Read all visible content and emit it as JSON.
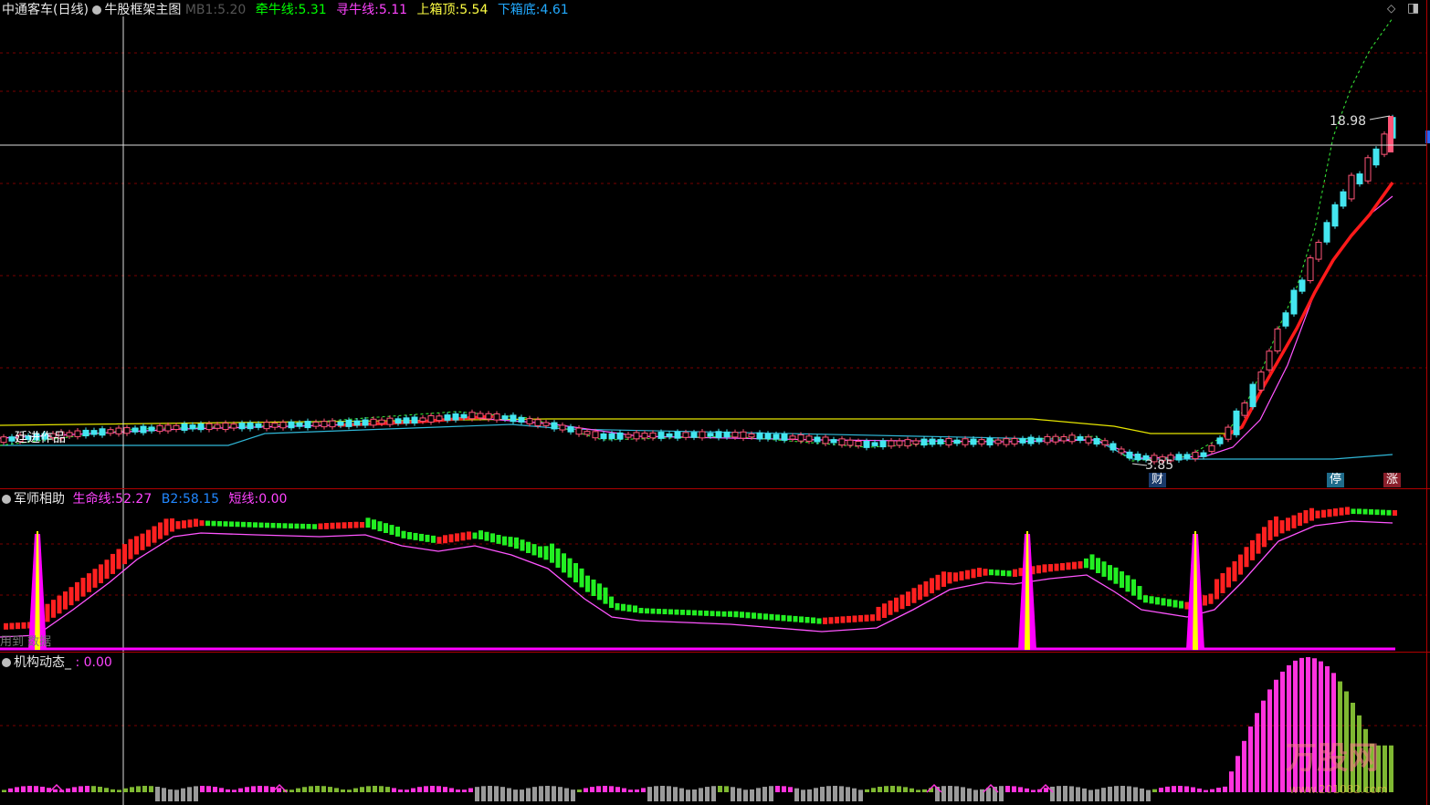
{
  "panel_main": {
    "stock_name": "中通客车(日线)",
    "indicator_name": "牛股框架主图",
    "mb1_label": "MB1:",
    "mb1_value": "5.20",
    "l1_label": "牵牛线:",
    "l1_value": "5.31",
    "l2_label": "寻牛线:",
    "l2_value": "5.11",
    "l3_label": "上箱顶:",
    "l3_value": "5.54",
    "l4_label": "下箱底:",
    "l4_value": "4.61",
    "author_text": "廷进作品",
    "high_price": "18.98",
    "low_price": "3.85",
    "tag_cai": "财",
    "tag_ting": "停",
    "tag_zhang": "涨"
  },
  "panel_mid": {
    "indicator_name": "军师相助",
    "l1_label": "生命线:",
    "l1_value": "52.27",
    "l2_label": "B2:",
    "l2_value": "58.15",
    "l3_label": "短线:",
    "l3_value": "0.00",
    "note_text": "用到 数据"
  },
  "panel_bottom": {
    "indicator_name": "机构动态_",
    "value_text": ": 0.00",
    "watermark": "万股网",
    "watermark_url": "www.201082.com"
  },
  "colors": {
    "up": "#ff3030",
    "down": "#00ff00",
    "magenta": "#ff00ff",
    "cyan": "#00e5ff",
    "yellow": "#ffff00",
    "grid": "#7a0000"
  }
}
